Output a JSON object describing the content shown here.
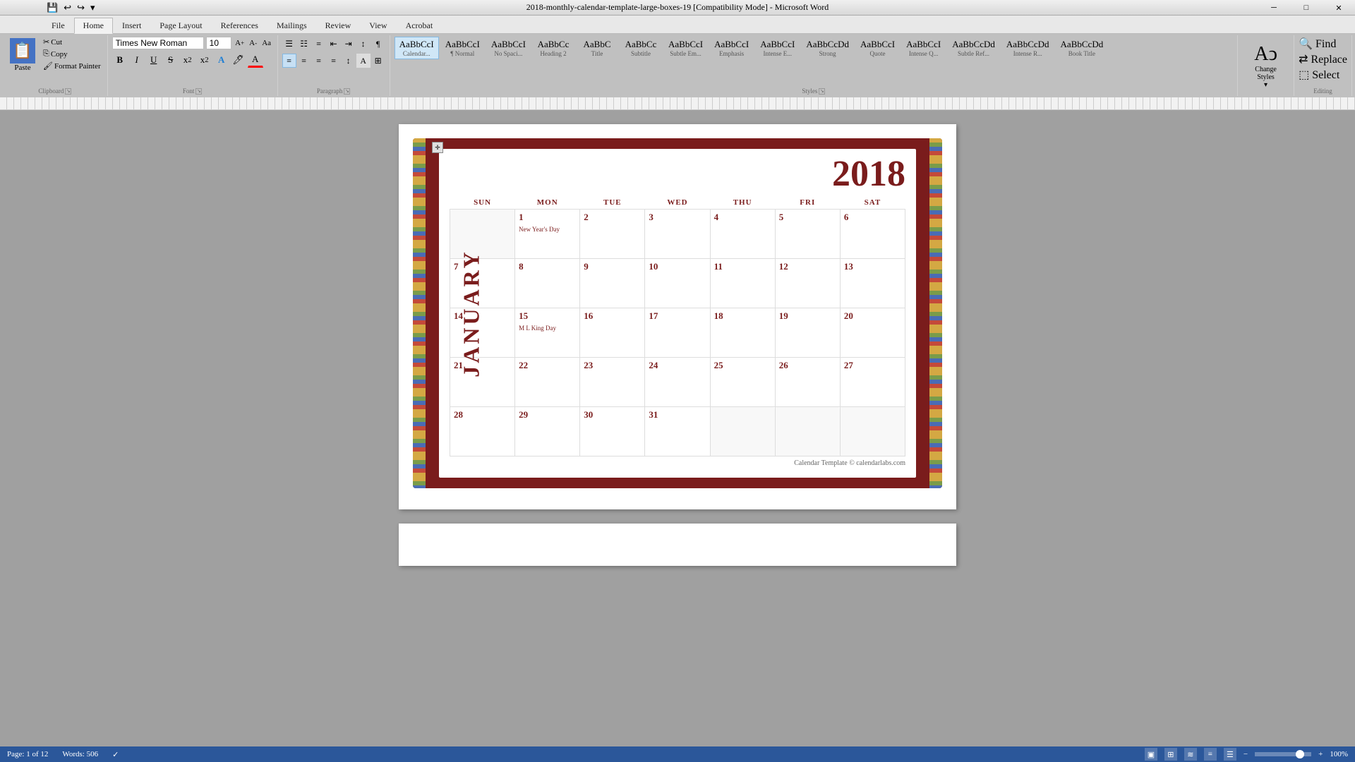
{
  "titlebar": {
    "title": "2018-monthly-calendar-template-large-boxes-19 [Compatibility Mode] - Microsoft Word",
    "minimize": "─",
    "maximize": "□",
    "close": "✕"
  },
  "tabs": [
    "File",
    "Home",
    "Insert",
    "Page Layout",
    "References",
    "Mailings",
    "Review",
    "View",
    "Acrobat"
  ],
  "active_tab": "Home",
  "clipboard": {
    "paste_label": "Paste",
    "cut_label": "Cut",
    "copy_label": "Copy",
    "format_painter_label": "Format Painter",
    "group_label": "Clipboard"
  },
  "font": {
    "name": "Times New Roman",
    "size": "10",
    "group_label": "Font"
  },
  "paragraph": {
    "group_label": "Paragraph"
  },
  "styles": {
    "group_label": "Styles",
    "items": [
      {
        "label": "Calendar...",
        "preview": "AaBbCcI",
        "active": true
      },
      {
        "label": "¶ Normal",
        "preview": "AaBbCcI",
        "active": false
      },
      {
        "label": "No Spaci...",
        "preview": "AaBbCcI",
        "active": false
      },
      {
        "label": "Heading 2",
        "preview": "AaBbCc",
        "active": false
      },
      {
        "label": "Title",
        "preview": "AaBbC",
        "active": false
      },
      {
        "label": "Subtitle",
        "preview": "AaBbCc",
        "active": false
      },
      {
        "label": "Subtle Em...",
        "preview": "AaBbCcI",
        "active": false
      },
      {
        "label": "Emphasis",
        "preview": "AaBbCcI",
        "active": false
      },
      {
        "label": "Intense E...",
        "preview": "AaBbCcI",
        "active": false
      },
      {
        "label": "Strong",
        "preview": "AaBbCcDd",
        "active": false
      },
      {
        "label": "Quote",
        "preview": "AaBbCcI",
        "active": false
      },
      {
        "label": "Intense Q...",
        "preview": "AaBbCcI",
        "active": false
      },
      {
        "label": "Subtle Ref...",
        "preview": "AaBbCcDd",
        "active": false
      },
      {
        "label": "Intense R...",
        "preview": "AaBbCcDd",
        "active": false
      },
      {
        "label": "Book Title",
        "preview": "AaBbCcDd",
        "active": false
      }
    ]
  },
  "change_styles": {
    "label": "Change\nStyles"
  },
  "editing": {
    "find_label": "Find",
    "replace_label": "Replace",
    "select_label": "Select",
    "group_label": "Editing"
  },
  "calendar": {
    "year": "2018",
    "month": "JANUARY",
    "days_header": [
      "SUN",
      "MON",
      "TUE",
      "WED",
      "THU",
      "FRI",
      "SAT"
    ],
    "weeks": [
      [
        {
          "day": "",
          "empty": true
        },
        {
          "day": "1",
          "holiday": "New Year's Day"
        },
        {
          "day": "2"
        },
        {
          "day": "3"
        },
        {
          "day": "4"
        },
        {
          "day": "5"
        },
        {
          "day": "6"
        }
      ],
      [
        {
          "day": "7"
        },
        {
          "day": "8"
        },
        {
          "day": "9"
        },
        {
          "day": "10"
        },
        {
          "day": "11"
        },
        {
          "day": "12"
        },
        {
          "day": "13"
        }
      ],
      [
        {
          "day": "14"
        },
        {
          "day": "15",
          "holiday": "M L King Day"
        },
        {
          "day": "16"
        },
        {
          "day": "17"
        },
        {
          "day": "18"
        },
        {
          "day": "19"
        },
        {
          "day": "20"
        }
      ],
      [
        {
          "day": "21"
        },
        {
          "day": "22"
        },
        {
          "day": "23"
        },
        {
          "day": "24"
        },
        {
          "day": "25"
        },
        {
          "day": "26"
        },
        {
          "day": "27"
        }
      ],
      [
        {
          "day": "28"
        },
        {
          "day": "29"
        },
        {
          "day": "30"
        },
        {
          "day": "31"
        },
        {
          "day": "",
          "empty": true
        },
        {
          "day": "",
          "empty": true
        },
        {
          "day": "",
          "empty": true
        }
      ]
    ],
    "footer": "Calendar Template © calendarlabs.com"
  },
  "status_bar": {
    "page": "Page: 1 of 12",
    "words": "Words: 506",
    "zoom": "100%"
  }
}
